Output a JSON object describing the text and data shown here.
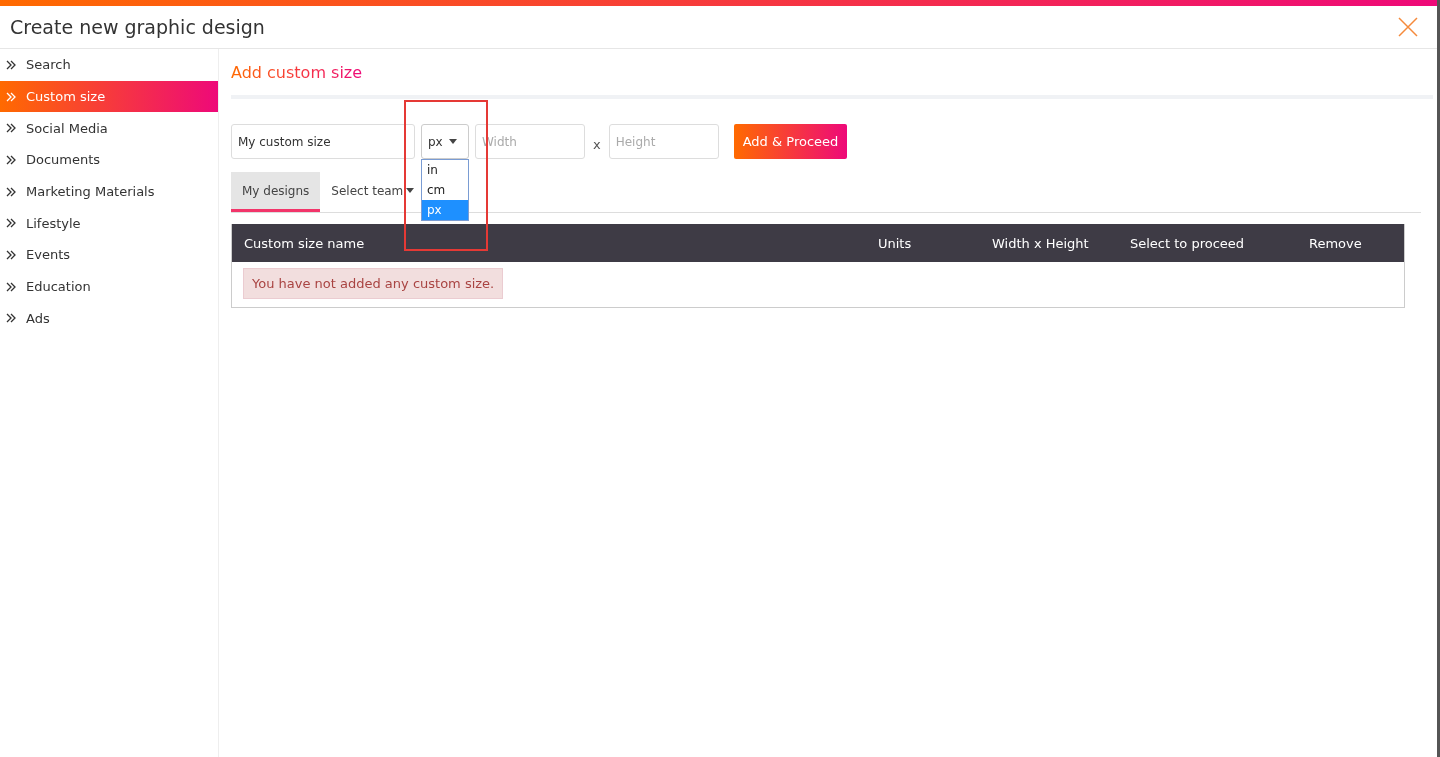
{
  "window": {
    "title": "Create new graphic design"
  },
  "sidebar": {
    "items": [
      {
        "label": "Search",
        "selected": false
      },
      {
        "label": "Custom size",
        "selected": true
      },
      {
        "label": "Social Media",
        "selected": false
      },
      {
        "label": "Documents",
        "selected": false
      },
      {
        "label": "Marketing Materials",
        "selected": false
      },
      {
        "label": "Lifestyle",
        "selected": false
      },
      {
        "label": "Events",
        "selected": false
      },
      {
        "label": "Education",
        "selected": false
      },
      {
        "label": "Ads",
        "selected": false
      }
    ]
  },
  "main": {
    "heading": "Add custom size",
    "form": {
      "name": {
        "value": "My custom size"
      },
      "unit": {
        "value": "px",
        "expanded": true,
        "options": [
          {
            "label": "in",
            "selected": false
          },
          {
            "label": "cm",
            "selected": false
          },
          {
            "label": "px",
            "selected": true
          }
        ]
      },
      "width": {
        "placeholder": "Width"
      },
      "separator": "x",
      "height": {
        "placeholder": "Height"
      },
      "submit": "Add & Proceed"
    },
    "tabs": [
      {
        "label": "My designs",
        "selected": true,
        "kind": "tab"
      },
      {
        "label": "Select team",
        "selected": false,
        "kind": "dropdown"
      }
    ],
    "table": {
      "columns": [
        "Custom size name",
        "Units",
        "Width x Height",
        "Select to proceed",
        "Remove"
      ],
      "empty_message": "You have not added any custom size."
    }
  }
}
